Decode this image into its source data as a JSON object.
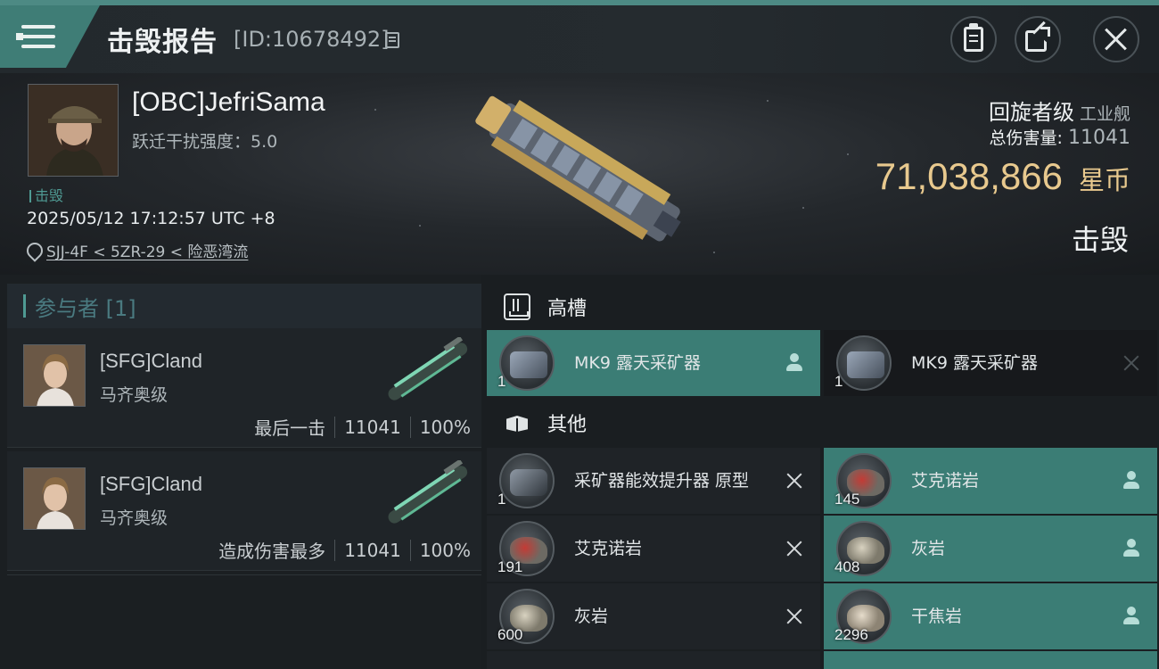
{
  "header": {
    "title": "击毁报告",
    "report_id": "[ID:10678492]"
  },
  "victim": {
    "name": "[OBC]JefriSama",
    "warp_label": "跃迁干扰强度：5.0",
    "role_tag": "击毁",
    "timestamp": "2025/05/12 17:12:57 UTC +8",
    "location": "SJJ-4F < 5ZR-29 < 险恶湾流",
    "ship_class": "回旋者级",
    "ship_type": "工业舰",
    "total_damage_label": "总伤害量:",
    "total_damage_value": "11041",
    "isk_value": "71,038,866",
    "isk_unit": "星币",
    "result": "击毁"
  },
  "participants": {
    "header": "参与者 [1]",
    "list": [
      {
        "name": "[SFG]Cland",
        "ship": "马齐奥级",
        "role": "最后一击",
        "damage": "11041",
        "percent": "100%"
      },
      {
        "name": "[SFG]Cland",
        "ship": "马齐奥级",
        "role": "造成伤害最多",
        "damage": "11041",
        "percent": "100%"
      }
    ]
  },
  "high_slot": {
    "title": "高槽",
    "items": [
      {
        "name": "MK9 露天采矿器",
        "qty": "1",
        "status": "dropped",
        "icon": "miner-icon"
      },
      {
        "name": "MK9 露天采矿器",
        "qty": "1",
        "status": "destroyed",
        "icon": "miner-icon"
      }
    ]
  },
  "other": {
    "title": "其他",
    "items": [
      {
        "name": "采矿器能效提升器 原型",
        "qty": "1",
        "status": "destroyed",
        "icon": "upgrade-icon"
      },
      {
        "name": "艾克诺岩",
        "qty": "145",
        "status": "dropped",
        "icon": "arkonor-ore-icon"
      },
      {
        "name": "艾克诺岩",
        "qty": "191",
        "status": "destroyed",
        "icon": "arkonor-ore-icon"
      },
      {
        "name": "灰岩",
        "qty": "408",
        "status": "dropped",
        "icon": "spodumain-ore-icon"
      },
      {
        "name": "灰岩",
        "qty": "600",
        "status": "destroyed",
        "icon": "spodumain-ore-icon"
      },
      {
        "name": "干焦岩",
        "qty": "2296",
        "status": "dropped",
        "icon": "pyroxeres-ore-icon"
      }
    ]
  },
  "colors": {
    "accent_teal": "#3b7d75",
    "isk_gold": "#e8c98e"
  }
}
